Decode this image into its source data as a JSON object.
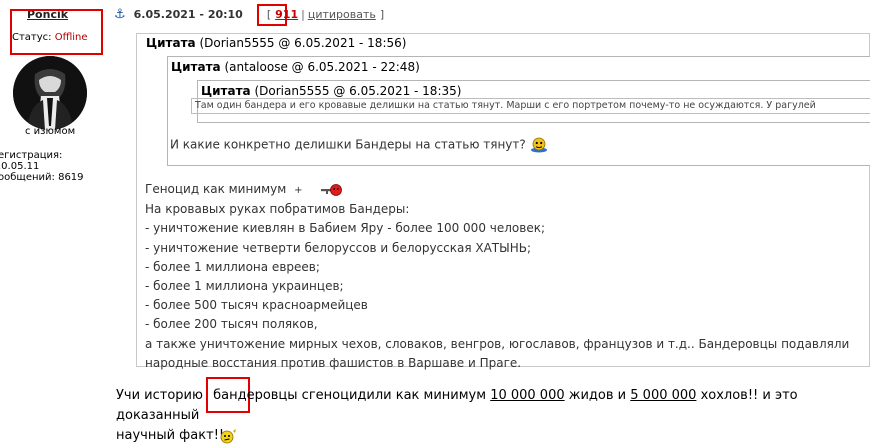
{
  "user": {
    "name": "Poncik",
    "status_label": "Статус:",
    "status_value": "Offline",
    "avatar_caption": "с изюмом",
    "reg_label": "егистрация:",
    "reg_date": ".0.05.11",
    "posts_label": "ообщений:",
    "posts_count": "8619"
  },
  "post": {
    "datetime": "6.05.2021 - 20:10",
    "number": "911",
    "cite_label": "цитировать"
  },
  "quote1": {
    "label": "Цитата",
    "meta": "(Dorian5555 @ 6.05.2021 - 18:56)",
    "body": [
      "Геноцид как минимум",
      "На кровавых руках побратимов Бандеры:",
      "- уничтожение киевлян в Бабием Яру - более 100 000 человек;",
      "- уничтожение четверти белоруссов и белорусская ХАТЫНЬ;",
      "- более 1 миллиона евреев;",
      "- более 1 миллиона украинцев;",
      "- более 500 тысяч красноармейцев",
      "- более 200 тысяч поляков,",
      "а также уничтожение мирных чехов, словаков, венгров, югославов, французов и т.д.. Бандеровцы подавляли",
      "народные восстания против фашистов в Варшаве и Праге."
    ],
    "plus_glyph": "+"
  },
  "quote2": {
    "label": "Цитата",
    "meta": "(antaloose @ 6.05.2021 - 22:48)",
    "text": "И какие конкретно делишки Бандеры на статью тянут?"
  },
  "quote3": {
    "label": "Цитата",
    "meta": "(Dorian5555 @ 6.05.2021 - 18:35)",
    "text": "Там один бандера и его кровавые делишки на статью тянут. Марши с его портретом почему-то не осуждаются. У рагулей"
  },
  "reply": {
    "part1": "Учи историю",
    "part2": "бандеровцы сгеноцидили как минимум",
    "n1": "10 000 000",
    "part3": "жидов и",
    "n2": "5 000 000",
    "part4": "хохлов!! и это доказанный",
    "part5": "научный факт!!"
  },
  "colors": {
    "highlight_box": "#e00000",
    "status_offline": "#b00000",
    "post_number": "#cc0000"
  }
}
